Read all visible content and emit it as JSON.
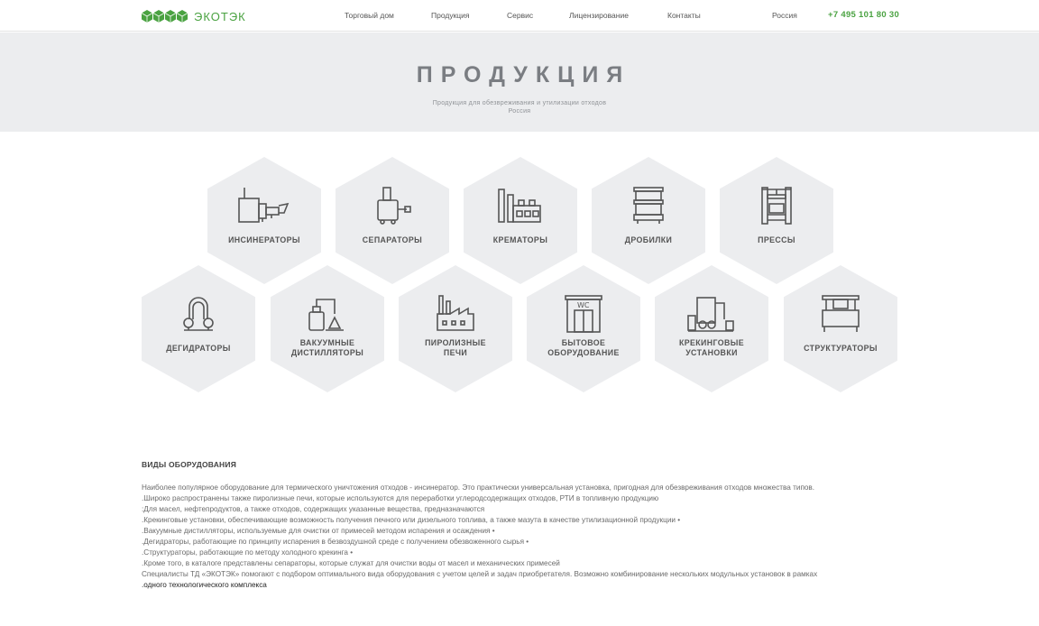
{
  "header": {
    "brand": "ЭКОТЭК",
    "nav": [
      {
        "label": "Торговый дом"
      },
      {
        "label": "Продукция"
      },
      {
        "label": "Сервис"
      },
      {
        "label": "Лицензирование"
      },
      {
        "label": "Контакты"
      }
    ],
    "region": "Россия",
    "phone": "+7 495 101 80 30",
    "brand_color": "#4aa241"
  },
  "hero": {
    "title": "ПРОДУКЦИЯ",
    "subtitle_line1": "Продукция для обезвреживания и утилизации отходов",
    "subtitle_line2": "Россия"
  },
  "products": [
    {
      "label_line1": "ИНСИНЕРАТОРЫ",
      "label_line2": "",
      "icon": "incinerator-icon"
    },
    {
      "label_line1": "СЕПАРАТОРЫ",
      "label_line2": "",
      "icon": "separator-icon"
    },
    {
      "label_line1": "КРЕМАТОРЫ",
      "label_line2": "",
      "icon": "crematorium-icon"
    },
    {
      "label_line1": "ДРОБИЛКИ",
      "label_line2": "",
      "icon": "crusher-icon"
    },
    {
      "label_line1": "ПРЕССЫ",
      "label_line2": "",
      "icon": "press-icon"
    },
    {
      "label_line1": "ДЕГИДРАТОРЫ",
      "label_line2": "",
      "icon": "dehydrator-icon"
    },
    {
      "label_line1": "ВАКУУМНЫЕ",
      "label_line2": "ДИСТИЛЛЯТОРЫ",
      "icon": "vacuum-distiller-icon"
    },
    {
      "label_line1": "ПИРОЛИЗНЫЕ",
      "label_line2": "ПЕЧИ",
      "icon": "pyrolysis-furnace-icon"
    },
    {
      "label_line1": "БЫТОВОЕ",
      "label_line2": "ОБОРУДОВАНИЕ",
      "icon": "household-wc-icon"
    },
    {
      "label_line1": "КРЕКИНГОВЫЕ",
      "label_line2": "УСТАНОВКИ",
      "icon": "cracking-plant-icon"
    },
    {
      "label_line1": "СТРУКТУРАТОРЫ",
      "label_line2": "",
      "icon": "structurator-icon"
    }
  ],
  "content": {
    "heading": "ВИДЫ ОБОРУДОВАНИЯ",
    "paragraphs": [
      "Наиболее популярное оборудование для термического уничтожения отходов - инсинератор. Это практически универсальная установка, пригодная для обезвреживания отходов множества типов.",
      ".Широко распространены также пиролизные печи, которые используются для переработки углеродсодержащих отходов, РТИ в топливную продукцию",
      ":Для масел, нефтепродуктов, а также отходов, содержащих указанные вещества, предназначаются",
      ".Крекинговые установки, обеспечивающие возможность получения печного или дизельного топлива, а также мазута в качестве утилизационной продукции •",
      ".Вакуумные дистилляторы, используемые для очистки от примесей методом испарения и осаждения •",
      ".Дегидраторы, работающие по принципу испарения в безвоздушной среде с получением обезвоженного сырья •",
      ".Структураторы, работающие по методу холодного крекинга •",
      ".Кроме того, в каталоге представлены сепараторы, которые служат для очистки воды от масел и механических примесей",
      "Специалисты ТД «ЭКОТЭК» помогают с подбором оптимального вида оборудования с учетом целей и задач приобретателя. Возможно комбинирование нескольких модульных установок в рамках",
      ".одного технологического комплекса"
    ]
  }
}
